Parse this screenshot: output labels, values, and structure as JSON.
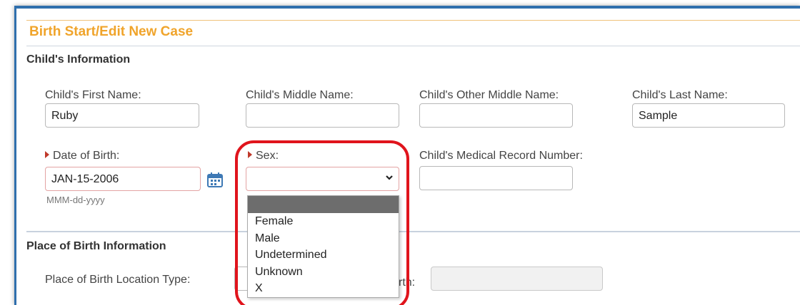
{
  "panel": {
    "title": "Birth Start/Edit New Case"
  },
  "child_section": {
    "header": "Child's Information",
    "first_name": {
      "label": "Child's First Name:",
      "value": "Ruby"
    },
    "middle_name": {
      "label": "Child's Middle Name:",
      "value": ""
    },
    "other_middle_name": {
      "label": "Child's Other Middle Name:",
      "value": ""
    },
    "last_name": {
      "label": "Child's Last Name:",
      "value": "Sample"
    },
    "dob": {
      "label": "Date of Birth:",
      "value": "JAN-15-2006",
      "hint": "MMM-dd-yyyy",
      "icon": "calendar-icon"
    },
    "sex": {
      "label": "Sex:",
      "value": "",
      "options": [
        "Female",
        "Male",
        "Undetermined",
        "Unknown",
        "X"
      ]
    },
    "mrn": {
      "label": "Child's Medical Record Number:",
      "value": ""
    }
  },
  "place_section": {
    "header": "Place of Birth Information",
    "location_type": {
      "label": "Place of Birth Location Type:"
    },
    "partial_label": "rth:"
  },
  "colors": {
    "title_orange": "#f0a42b",
    "frame_blue": "#2f6fad",
    "required_marker": "#c0392b",
    "callout_red": "#e0141c",
    "calendar_blue": "#3e79b5"
  }
}
